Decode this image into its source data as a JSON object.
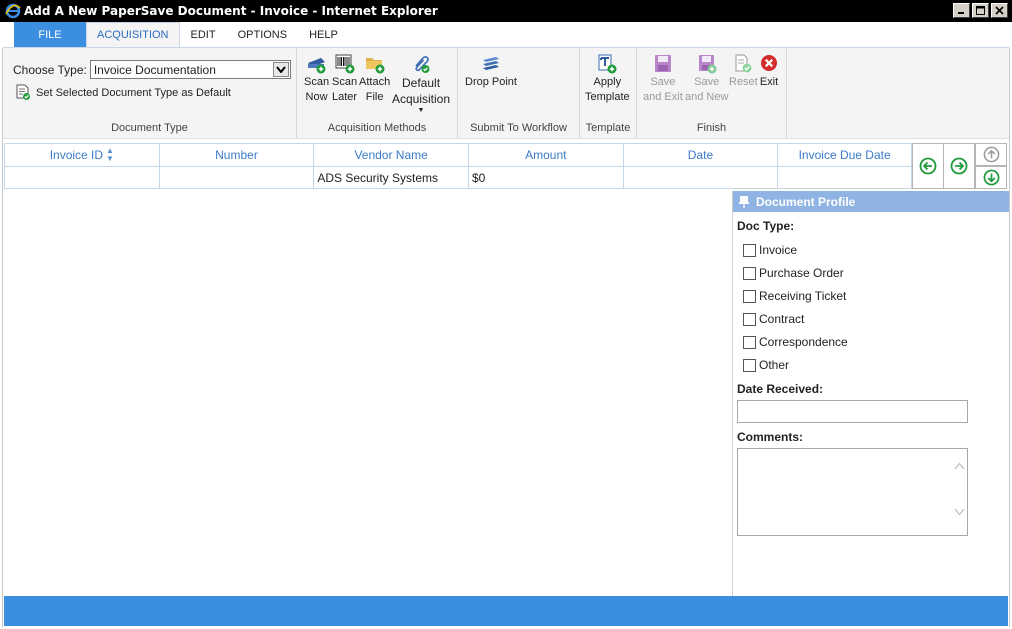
{
  "window": {
    "title": "Add A New PaperSave Document - Invoice - Internet Explorer"
  },
  "menu": {
    "tabs": [
      {
        "label": "FILE"
      },
      {
        "label": "ACQUISITION"
      },
      {
        "label": "EDIT"
      },
      {
        "label": "OPTIONS"
      },
      {
        "label": "HELP"
      }
    ],
    "active": "ACQUISITION"
  },
  "ribbon": {
    "document_type": {
      "choose_label": "Choose Type:",
      "selected": "Invoice Documentation",
      "set_default_label": "Set Selected Document Type as Default",
      "group_label": "Document Type"
    },
    "acquisition": {
      "scan_now_1": "Scan",
      "scan_now_2": "Now",
      "scan_later_1": "Scan",
      "scan_later_2": "Later",
      "attach_1": "Attach",
      "attach_2": "File",
      "default_1": "Default",
      "default_2": "Acquisition",
      "group_label": "Acquisition Methods"
    },
    "workflow": {
      "drop_point": "Drop Point",
      "group_label": "Submit To Workflow"
    },
    "template": {
      "apply_1": "Apply",
      "apply_2": "Template",
      "group_label": "Template"
    },
    "finish": {
      "save_exit_1": "Save",
      "save_exit_2": "and Exit",
      "save_new_1": "Save",
      "save_new_2": "and New",
      "reset": "Reset",
      "exit": "Exit",
      "group_label": "Finish"
    }
  },
  "grid": {
    "columns": [
      "Invoice ID",
      "Number",
      "Vendor Name",
      "Amount",
      "Date",
      "Invoice Due Date"
    ],
    "rows": [
      [
        "",
        "",
        "ADS Security Systems",
        "$0",
        "",
        ""
      ]
    ]
  },
  "profile": {
    "title": "Document Profile",
    "doc_type_label": "Doc Type:",
    "doc_types": [
      "Invoice",
      "Purchase Order",
      "Receiving Ticket",
      "Contract",
      "Correspondence",
      "Other"
    ],
    "date_received_label": "Date Received:",
    "date_received_value": "",
    "comments_label": "Comments:",
    "comments_value": ""
  },
  "colors": {
    "accent": "#3c8fe0",
    "profile_header": "#8fb4e3",
    "grid_header_text": "#3b7bc8",
    "nav_green": "#1f9a3a"
  }
}
